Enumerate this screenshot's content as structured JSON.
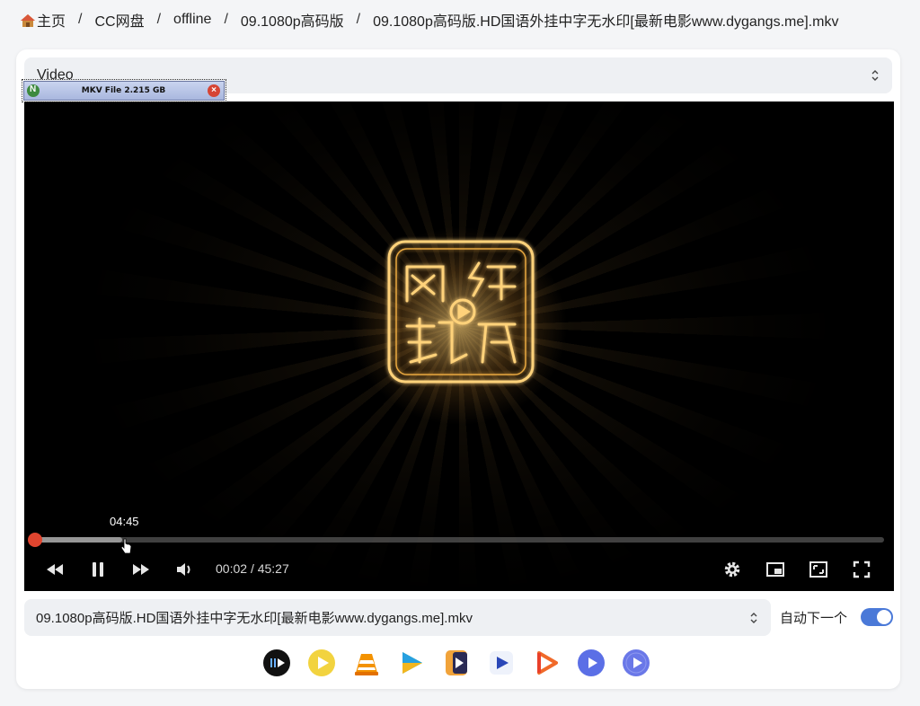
{
  "breadcrumb": {
    "items": [
      "主页",
      "CC网盘",
      "offline",
      "09.1080p高码版",
      "09.1080p高码版.HD国语外挂中字无水印[最新电影www.dygangs.me].mkv"
    ],
    "separator": "/"
  },
  "source_select": {
    "value": "Video"
  },
  "mkv_badge": {
    "text": "MKV File 2.215 GB"
  },
  "player": {
    "hover_time": "04:45",
    "current_time": "00:02",
    "time_sep": "/",
    "duration": "45:27",
    "progress_fraction": 0.0007,
    "hover_fraction": 0.104,
    "accent_color": "#e0452f"
  },
  "file_select": {
    "value": "09.1080p高码版.HD国语外挂中字无水印[最新电影www.dygangs.me].mkv"
  },
  "auto_next": {
    "label": "自动下一个",
    "enabled": true,
    "color": "#4a79d8"
  },
  "external_players": [
    "iina-icon",
    "potplayer-icon",
    "vlc-icon",
    "mx-player-icon",
    "infuse-icon",
    "nplayer-icon",
    "omni-player-icon",
    "figplayer-icon",
    "mpv-icon"
  ]
}
